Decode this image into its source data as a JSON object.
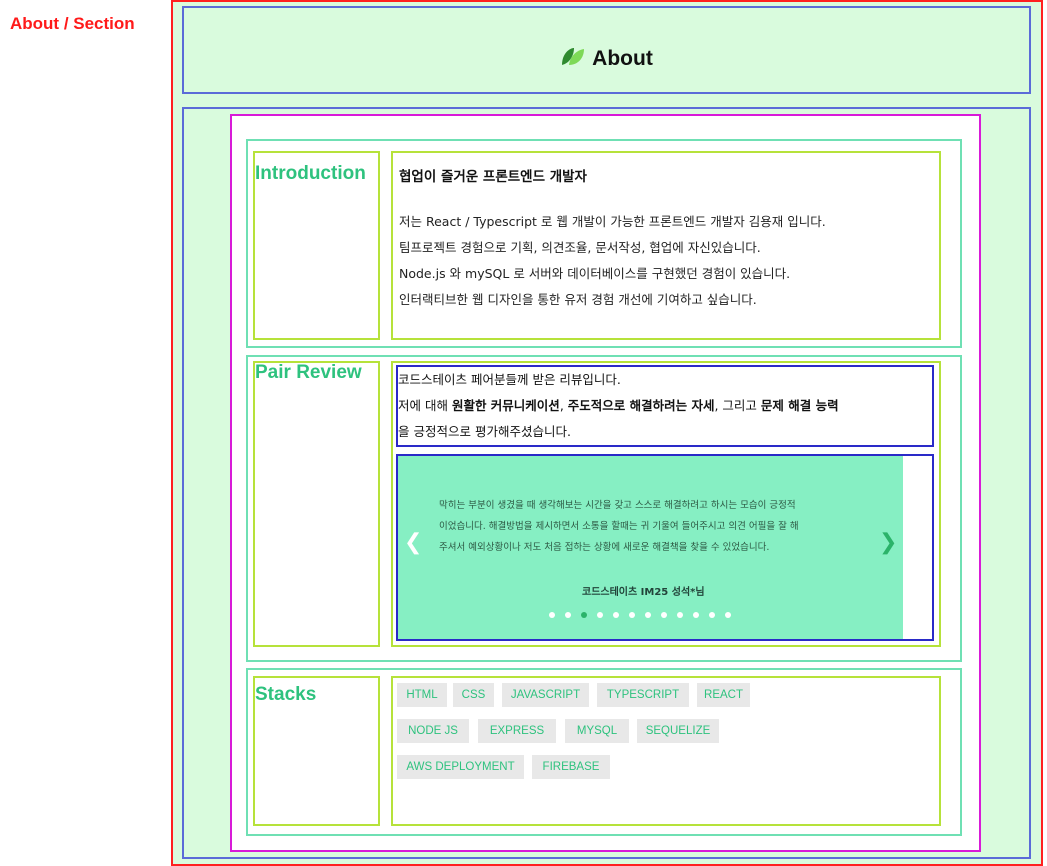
{
  "section_label": "About / Section",
  "header": {
    "icon": "leaf-icon",
    "title": "About"
  },
  "intro": {
    "title": "Introduction",
    "heading": "협업이 즐거운 프론트엔드 개발자",
    "lines": [
      "저는 React / Typescript 로 웹 개발이 가능한 프론트엔드 개발자 김용재 입니다.",
      "팀프로젝트 경험으로 기획, 의견조율, 문서작성, 협업에 자신있습니다.",
      "Node.js 와 mySQL 로 서버와 데이터베이스를 구현했던 경험이 있습니다.",
      "인터랙티브한 웹 디자인을 통한 유저 경험 개선에 기여하고 싶습니다."
    ]
  },
  "review": {
    "title": "Pair Review",
    "line1": "코드스테이츠 페어분들께 받은 리뷰입니다.",
    "line2_prefix": "저에 대해 ",
    "line2_bold1": "원활한 커뮤니케이션",
    "line2_sep1": ", ",
    "line2_bold2": "주도적으로 해결하려는 자세",
    "line2_sep2": ", 그리고 ",
    "line2_bold3": "문제 해결 능력",
    "line3": "을 긍정적으로 평가해주셨습니다.",
    "slide": {
      "lines": [
        "막히는 부분이 생겼을 때 생각해보는 시간을 갖고 스스로 해결하려고 하시는 모습이 긍정적",
        "이었습니다. 해결방법을 제시하면서 소통을 할때는 귀 기울여 들어주시고 의견 어필을 잘 해",
        "주셔서 예외상황이나 저도 처음 접하는 상황에 새로운 해결책을 찾을 수 있었습니다."
      ],
      "author": "코드스테이츠 IM25 성석*님"
    },
    "dots_total": 12,
    "dots_active": 3,
    "prev_icon": "chevron-left-icon",
    "next_icon": "chevron-right-icon"
  },
  "stacks": {
    "title": "Stacks",
    "items": [
      "HTML",
      "CSS",
      "JAVASCRIPT",
      "TYPESCRIPT",
      "REACT",
      "NODE JS",
      "EXPRESS",
      "MYSQL",
      "SEQUELIZE",
      "AWS DEPLOYMENT",
      "FIREBASE"
    ]
  },
  "colors": {
    "accent": "#2ec27e",
    "page_bg": "#d9fbdd",
    "slide_bg": "#86efc3",
    "label_red": "#ff1a1a"
  }
}
